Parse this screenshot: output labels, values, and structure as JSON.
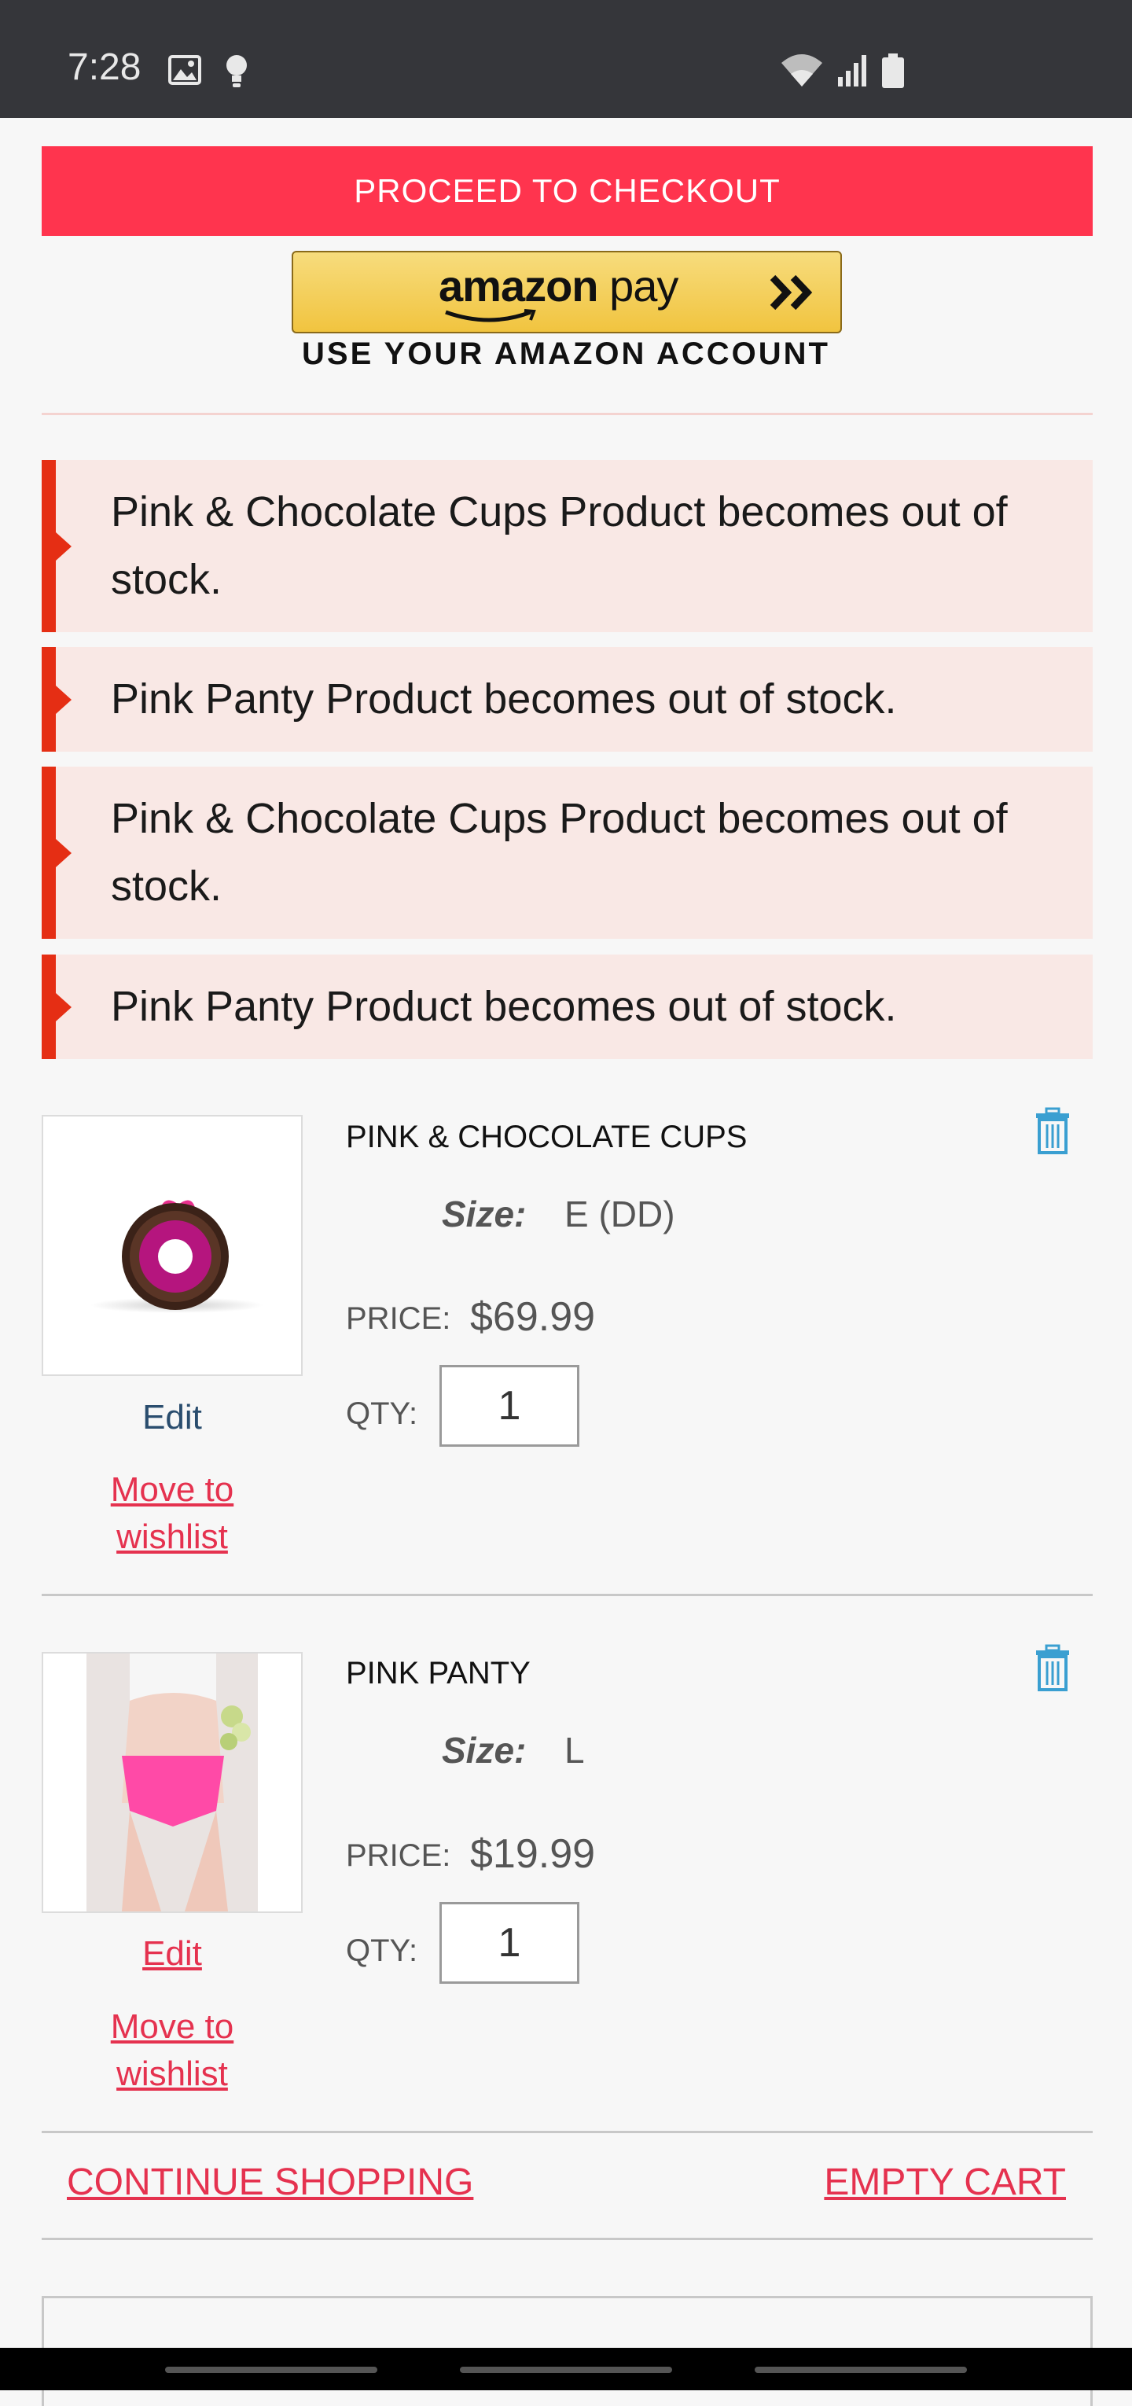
{
  "status_bar": {
    "time": "7:28",
    "icons": [
      "image-icon",
      "bulb-icon",
      "wifi-icon",
      "signal-icon",
      "battery-icon"
    ]
  },
  "checkout": {
    "button_label": "PROCEED TO CHECKOUT",
    "amazon_pay_bold": "amazon",
    "amazon_pay_light": "pay",
    "amazon_caption": "USE YOUR AMAZON ACCOUNT"
  },
  "alerts": [
    "Pink & Chocolate Cups Product becomes out of stock.",
    "Pink Panty Product becomes out of stock.",
    "Pink & Chocolate Cups Product becomes out of stock.",
    "Pink Panty Product becomes out of stock."
  ],
  "cart": {
    "items": [
      {
        "name": "PINK & CHOCOLATE CUPS",
        "size_label": "Size:",
        "size": "E (DD)",
        "price_label": "PRICE:",
        "price": "$69.99",
        "qty_label": "QTY:",
        "qty": "1",
        "edit_label": "Edit",
        "wishlist_label_1": "Move to",
        "wishlist_label_2": "wishlist",
        "edit_color": "#2a4d6e"
      },
      {
        "name": "PINK PANTY",
        "size_label": "Size:",
        "size": "L",
        "price_label": "PRICE:",
        "price": "$19.99",
        "qty_label": "QTY:",
        "qty": "1",
        "edit_label": "Edit",
        "wishlist_label_1": "Move to",
        "wishlist_label_2": "wishlist",
        "edit_color": "#e5324f"
      }
    ],
    "continue_label": "CONTINUE SHOPPING",
    "empty_label": "EMPTY CART"
  },
  "colors": {
    "accent": "#ff344e",
    "link": "#e5324f",
    "alert_bar": "#e52e14",
    "alert_bg": "#f9e8e5",
    "trash": "#3a9fd1"
  }
}
